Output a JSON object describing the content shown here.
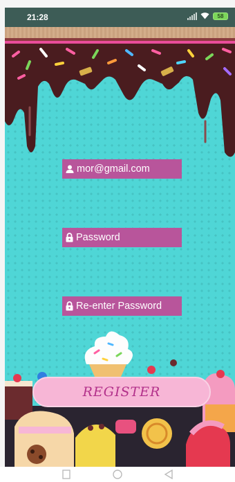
{
  "status_bar": {
    "time": "21:28",
    "battery": "58",
    "icons": [
      "signal-icon",
      "wifi-icon",
      "battery-icon"
    ]
  },
  "form": {
    "email": {
      "value": "mor@gmail.com",
      "icon": "user-icon"
    },
    "password": {
      "placeholder": "Password",
      "icon": "lock-icon"
    },
    "repassword": {
      "placeholder": "Re-enter Password",
      "icon": "lock-icon"
    }
  },
  "register_button": {
    "label": "REGISTER"
  },
  "nav_bar": {
    "icons": [
      "recents-square-icon",
      "home-circle-icon",
      "back-triangle-icon"
    ]
  },
  "colors": {
    "background": "#4fd6d6",
    "field": "#b8559b",
    "button": "#f7b6d6",
    "button_text": "#b2308a",
    "chocolate": "#4a1c1f",
    "status_bar": "#3d5c56"
  }
}
